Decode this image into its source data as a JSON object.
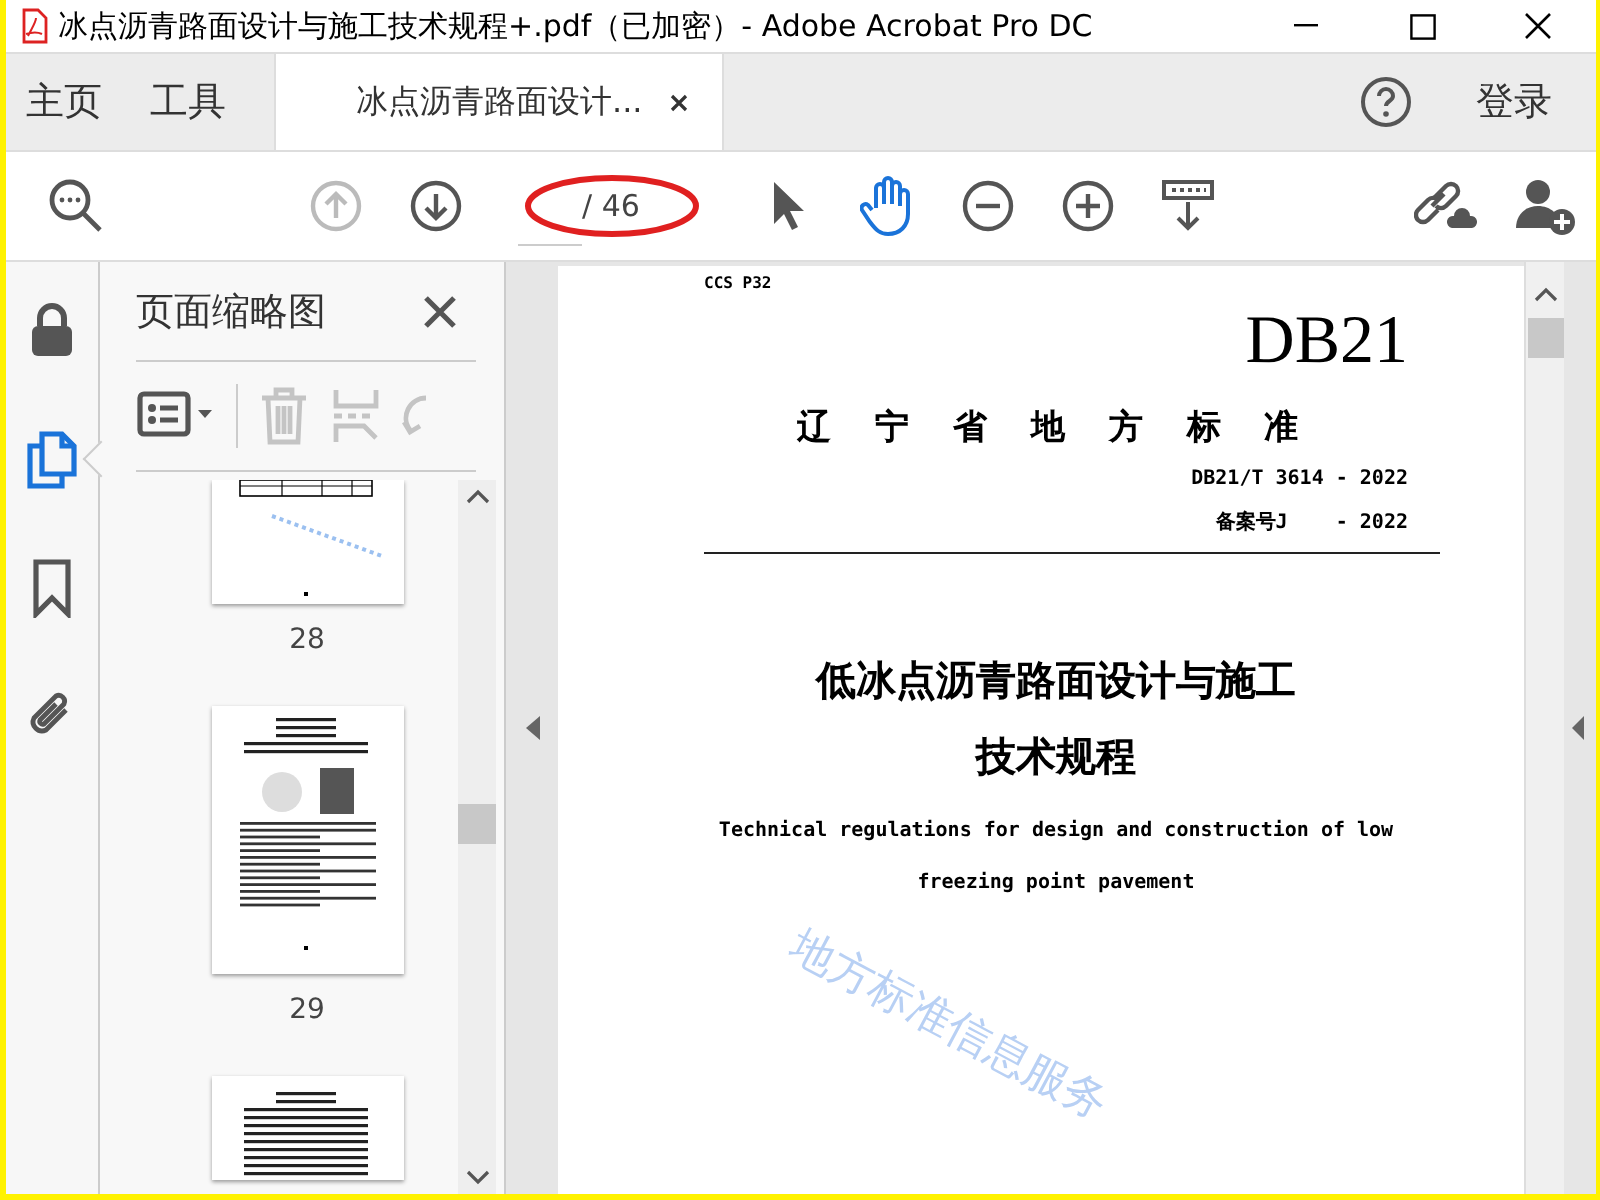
{
  "window": {
    "title": "冰点沥青路面设计与施工技术规程+.pdf（已加密）- Adobe Acrobat Pro DC"
  },
  "nav_tabs": [
    {
      "label": "主页",
      "selected": false
    },
    {
      "label": "工具",
      "selected": false
    },
    {
      "label": "冰点沥青路面设计...",
      "selected": true
    }
  ],
  "signin": "登录",
  "toolbar": {
    "search_tools": [
      {
        "kind": "find",
        "selected": false,
        "disabled": false
      }
    ],
    "page_tools": [
      {
        "kind": "prev",
        "selected": false,
        "disabled": true
      },
      {
        "kind": "next",
        "selected": false,
        "disabled": false
      }
    ],
    "page_count": "/ 46",
    "view_tools": [
      {
        "kind": "pointer",
        "selected": false,
        "disabled": false
      },
      {
        "kind": "hand",
        "selected": true,
        "disabled": false
      },
      {
        "kind": "zoomout",
        "selected": false,
        "disabled": false
      },
      {
        "kind": "zoomin",
        "selected": false,
        "disabled": false
      },
      {
        "kind": "ruler",
        "selected": false,
        "disabled": false
      }
    ],
    "share_tools": [
      {
        "kind": "link",
        "selected": false,
        "disabled": false
      },
      {
        "kind": "adduser",
        "selected": false,
        "disabled": false
      }
    ]
  },
  "annotation": {
    "kind": "ellipse",
    "color": "#e02020"
  },
  "rail": [
    {
      "kind": "lock",
      "selected": false
    },
    {
      "kind": "pages",
      "selected": true
    },
    {
      "kind": "bookmark",
      "selected": false
    },
    {
      "kind": "attachment",
      "selected": false
    }
  ],
  "thumbnails_panel": {
    "title": "页面缩略图",
    "tools": [
      {
        "kind": "options",
        "disabled": false
      },
      {
        "kind": "delete",
        "disabled": true
      },
      {
        "kind": "extract",
        "disabled": true
      },
      {
        "kind": "rotate",
        "disabled": true
      }
    ],
    "pages": [
      {
        "kind": "table",
        "label": "28"
      },
      {
        "kind": "photos",
        "label": "29"
      },
      {
        "kind": "text"
      }
    ]
  },
  "document": {
    "classification": "CCS P32",
    "code": "DB21",
    "authority": "辽 宁 省 地 方 标 准",
    "number": "DB21/T 3614 - 2022",
    "record": "备案号J    - 2022",
    "title_lines": [
      "低冰点沥青路面设计与施工",
      "技术规程"
    ],
    "english_lines": [
      "Technical regulations for design and construction of low",
      "freezing point pavement"
    ],
    "stamp": "地方标准信息服务"
  }
}
